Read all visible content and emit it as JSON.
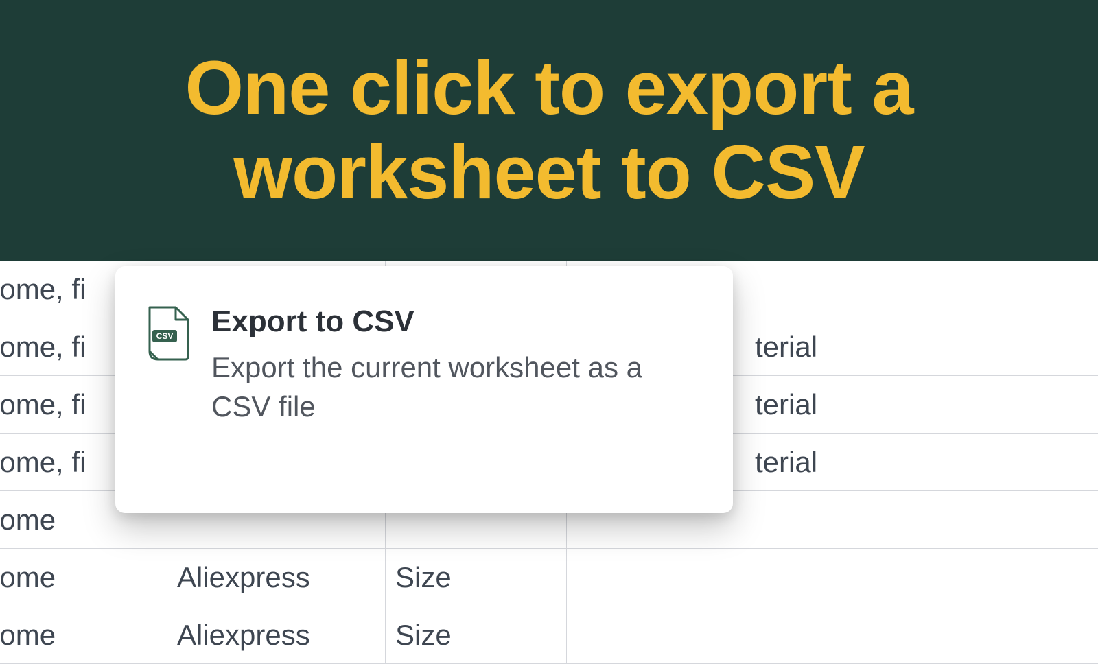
{
  "banner": {
    "title": "One click to export a worksheet to CSV"
  },
  "popup": {
    "title": "Export to CSV",
    "description": "Export the current worksheet as a CSV file",
    "icon_text": "CSV"
  },
  "sheet": {
    "rows": [
      {
        "a": "vesome, fi",
        "b": "",
        "c": "",
        "d": "",
        "e": ""
      },
      {
        "a": "vesome, fi",
        "b": "",
        "c": "",
        "d": "",
        "e": "terial"
      },
      {
        "a": "vesome, fi",
        "b": "",
        "c": "",
        "d": "",
        "e": "terial"
      },
      {
        "a": "vesome, fi",
        "b": "",
        "c": "",
        "d": "",
        "e": "terial"
      },
      {
        "a": "vesome",
        "b": "",
        "c": "",
        "d": "",
        "e": ""
      },
      {
        "a": "vesome",
        "b": "Aliexpress",
        "c": "Size",
        "d": "",
        "e": ""
      },
      {
        "a": "vesome",
        "b": "Aliexpress",
        "c": "Size",
        "d": "",
        "e": ""
      }
    ]
  }
}
